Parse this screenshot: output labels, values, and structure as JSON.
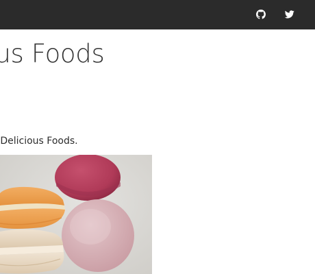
{
  "header": {
    "links": [
      {
        "icon": "github-icon",
        "label": "GitHub"
      },
      {
        "icon": "twitter-icon",
        "label": "Twitter"
      }
    ],
    "background": "#2b2b2b",
    "icon_color": "#ffffff"
  },
  "main": {
    "title": "ous Foods",
    "text": "l Delicious Foods.",
    "image": {
      "subject": "macarons",
      "colors": [
        "#b8405f",
        "#f3a556",
        "#e9d8c4",
        "#d7b0b6",
        "#d9d8d5"
      ]
    }
  }
}
